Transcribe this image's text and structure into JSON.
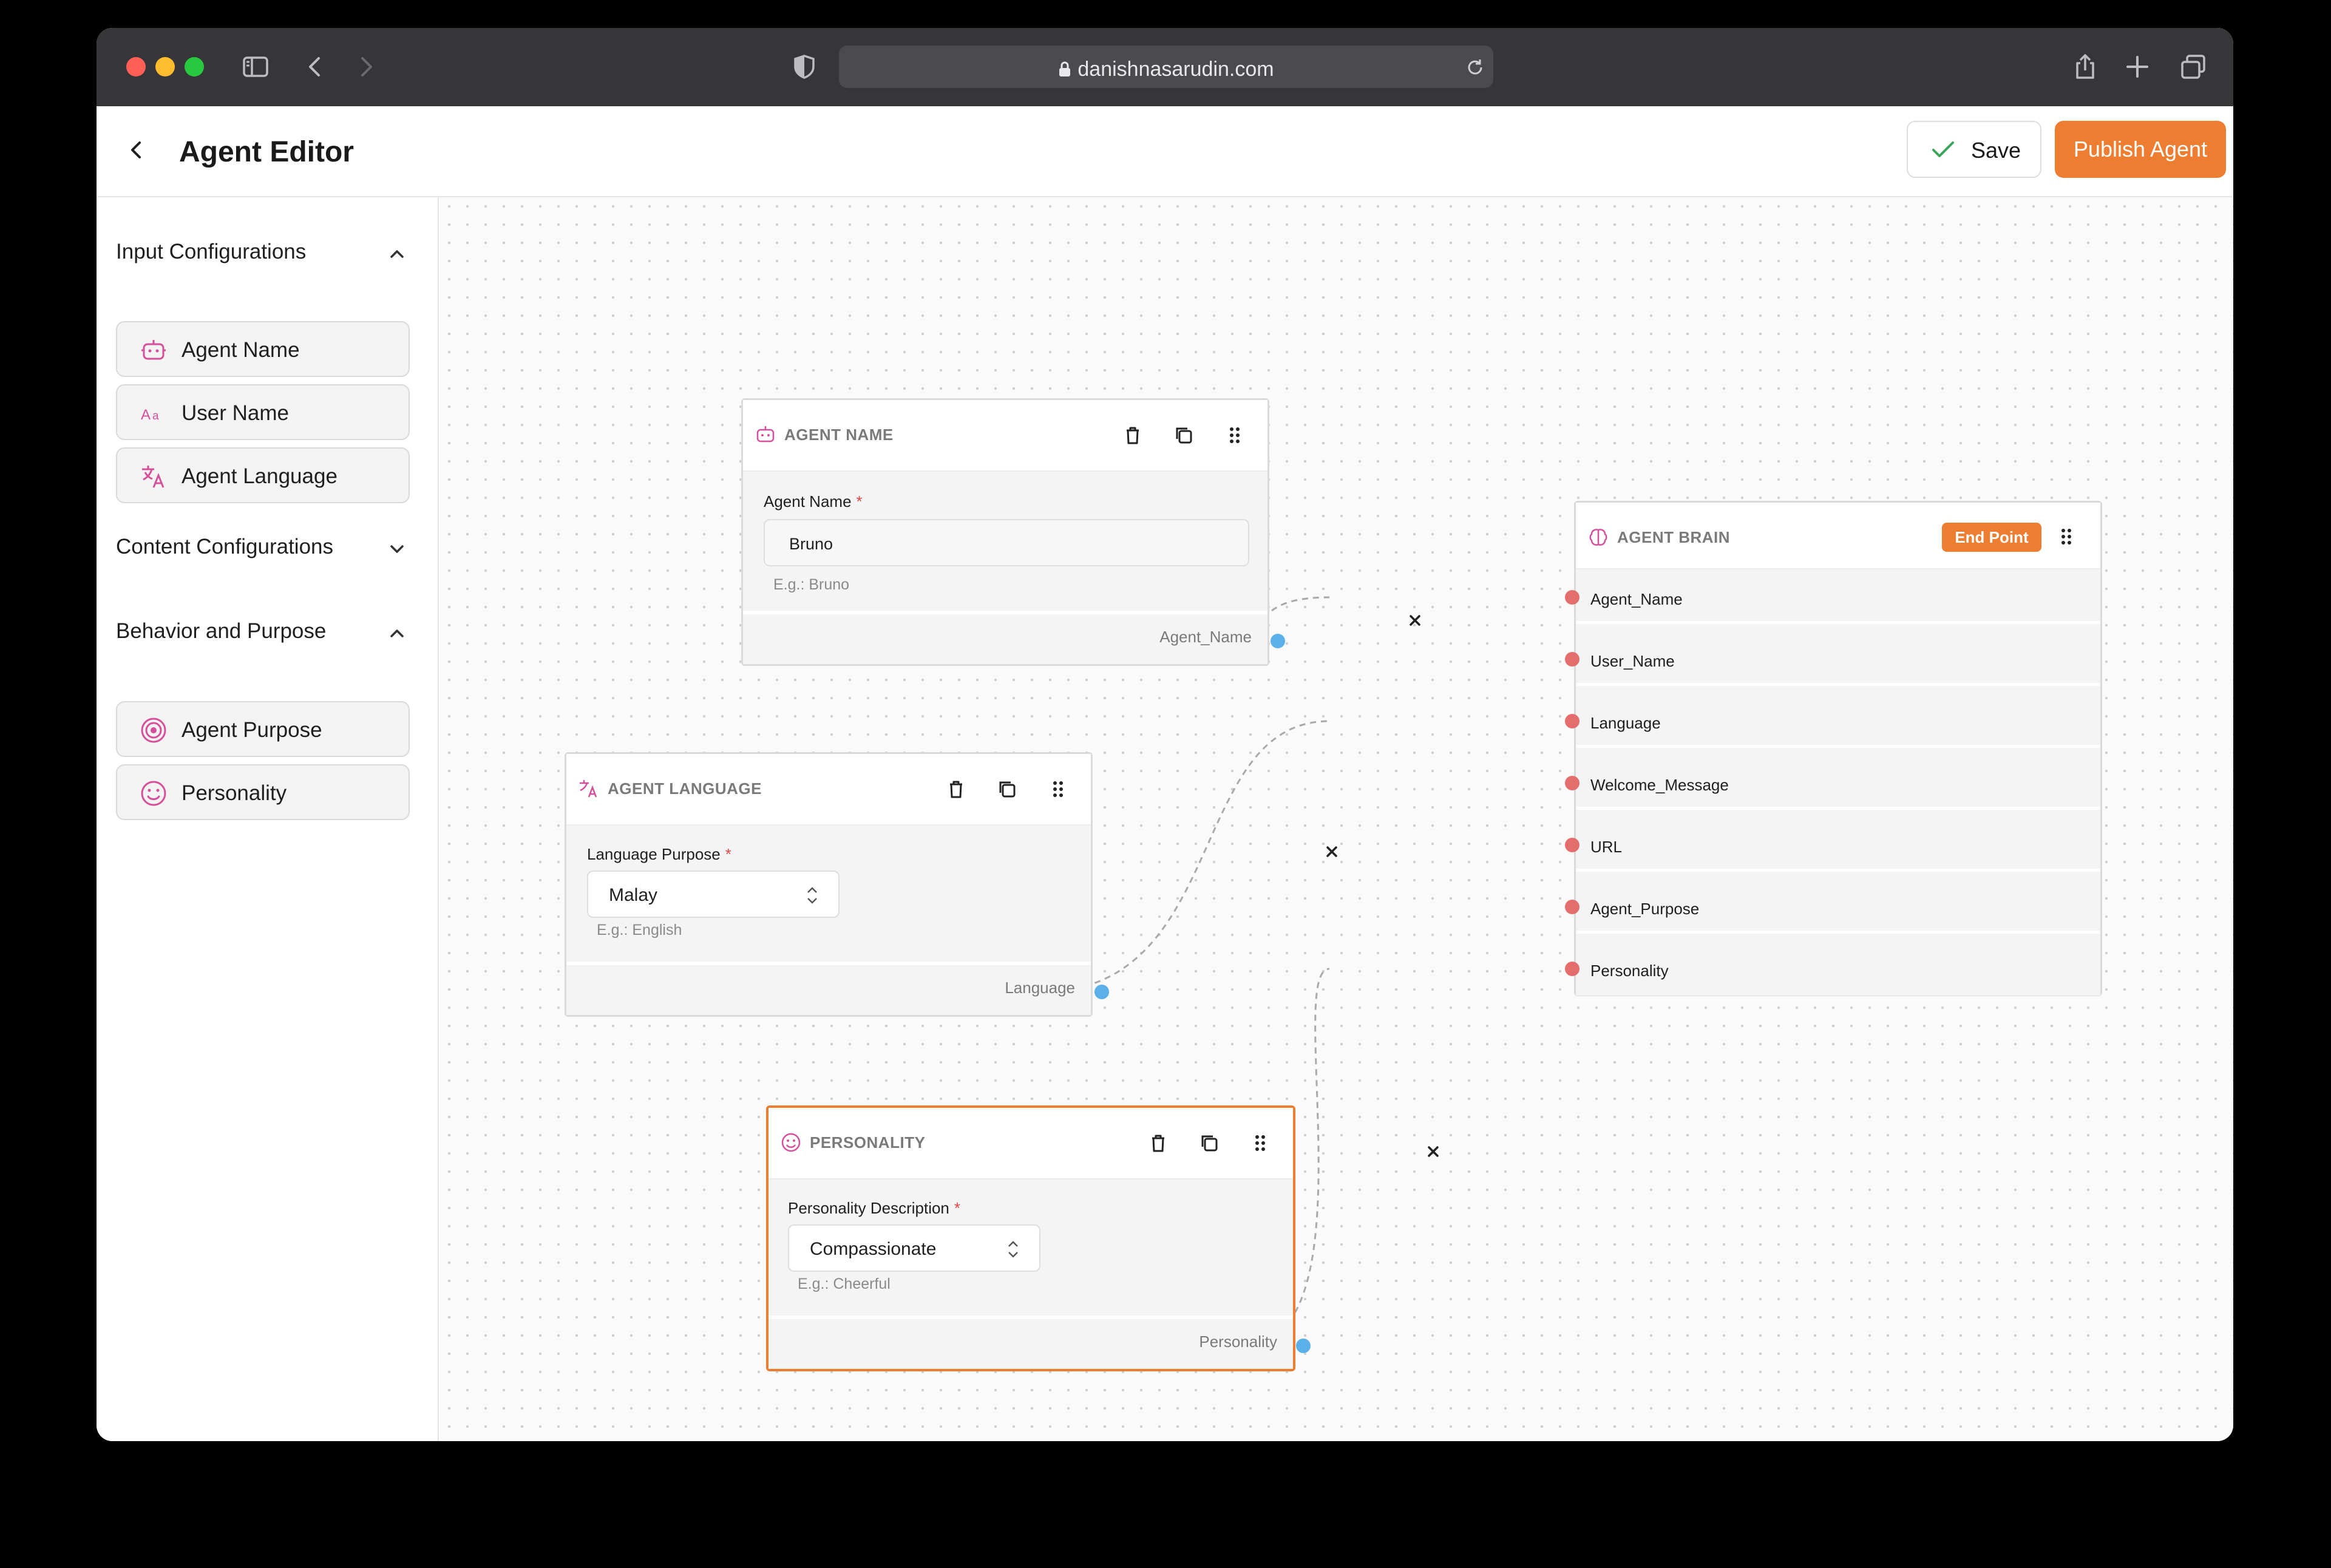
{
  "browser": {
    "url": "danishnasarudin.com"
  },
  "header": {
    "title": "Agent Editor",
    "save_label": "Save",
    "publish_label": "Publish Agent"
  },
  "sidebar": {
    "input_section": {
      "title": "Input Configurations",
      "items": [
        {
          "label": "Agent Name",
          "icon": "bot-icon"
        },
        {
          "label": "User Name",
          "icon": "text-aa-icon"
        },
        {
          "label": "Agent Language",
          "icon": "translate-icon"
        }
      ]
    },
    "content_section": {
      "title": "Content Configurations"
    },
    "behavior_section": {
      "title": "Behavior and Purpose",
      "items": [
        {
          "label": "Agent Purpose",
          "icon": "target-icon"
        },
        {
          "label": "Personality",
          "icon": "smile-icon"
        }
      ]
    }
  },
  "nodes": {
    "agent_name": {
      "title": "AGENT NAME",
      "field_label": "Agent Name",
      "required": "*",
      "value": "Bruno",
      "hint": "E.g.: Bruno",
      "output": "Agent_Name"
    },
    "agent_language": {
      "title": "AGENT LANGUAGE",
      "field_label": "Language Purpose",
      "required": "*",
      "value": "Malay",
      "hint": "E.g.: English",
      "output": "Language"
    },
    "personality": {
      "title": "PERSONALITY",
      "field_label": "Personality Description",
      "required": "*",
      "value": "Compassionate",
      "hint": "E.g.: Cheerful",
      "output": "Personality"
    },
    "agent_brain": {
      "title": "AGENT BRAIN",
      "badge": "End Point",
      "inputs": [
        "Agent_Name",
        "User_Name",
        "Language",
        "Welcome_Message",
        "URL",
        "Agent_Purpose",
        "Personality"
      ]
    }
  },
  "colors": {
    "accent": "#ed7d31",
    "handle_out": "#5bb0ea",
    "handle_in": "#e46e6e"
  }
}
